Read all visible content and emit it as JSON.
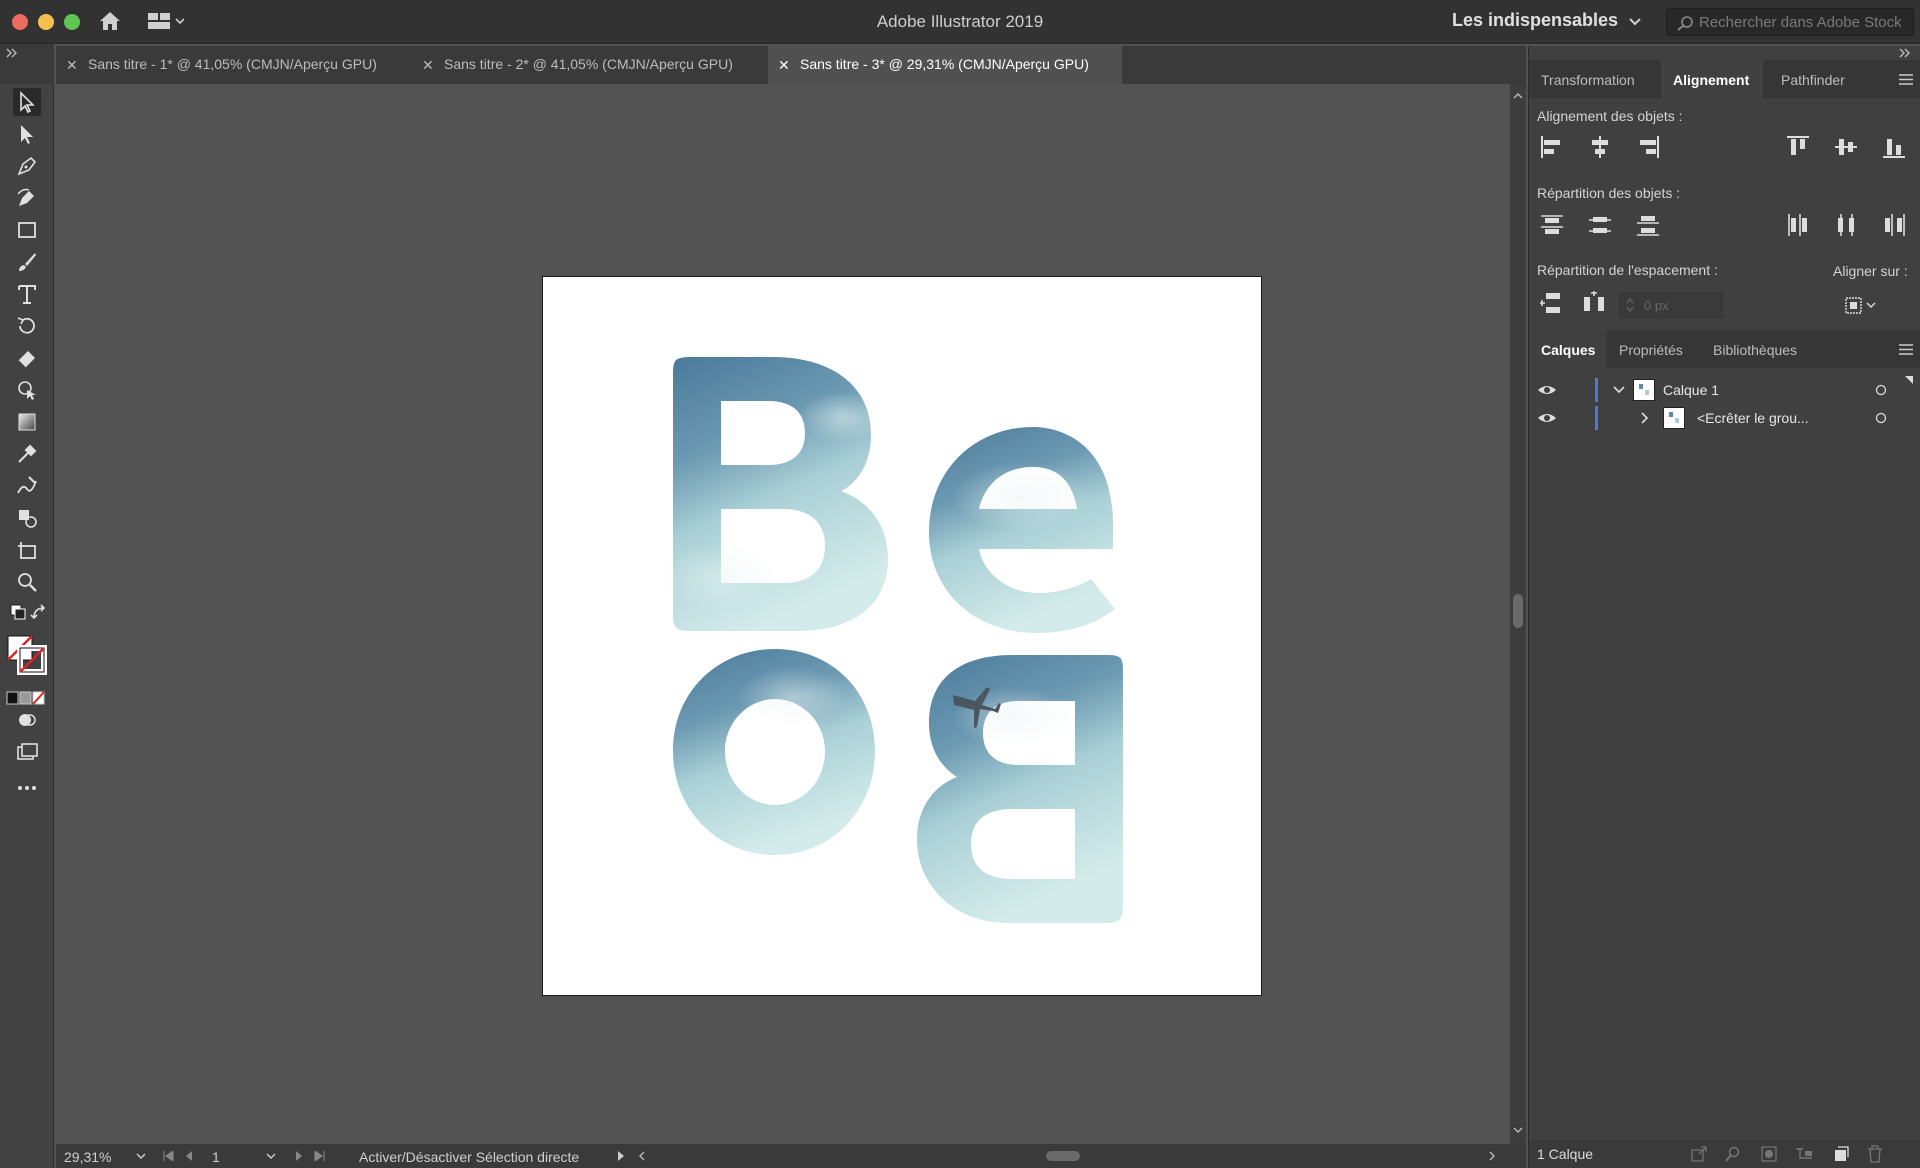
{
  "window": {
    "title": "Adobe Illustrator 2019",
    "workspace": "Les indispensables",
    "search_placeholder": "Rechercher dans Adobe Stock"
  },
  "tabs": [
    {
      "label": "Sans titre - 1* @ 41,05% (CMJN/Aperçu GPU)"
    },
    {
      "label": "Sans titre - 2* @ 41,05% (CMJN/Aperçu GPU)"
    },
    {
      "label": "Sans titre - 3* @ 29,31% (CMJN/Aperçu GPU)",
      "active": true
    }
  ],
  "panel_top": {
    "tabs": [
      "Transformation",
      "Alignement",
      "Pathfinder"
    ],
    "active_tab": "Alignement",
    "align_objects_label": "Alignement des objets :",
    "distribute_objects_label": "Répartition des objets :",
    "distribute_spacing_label": "Répartition de l'espacement :",
    "align_to_label": "Aligner sur :",
    "spacing_value": "0 px"
  },
  "panel_layers": {
    "tabs": [
      "Calques",
      "Propriétés",
      "Bibliothèques"
    ],
    "active_tab": "Calques",
    "layers": [
      {
        "name": "Calque 1",
        "expanded": true
      },
      {
        "name": "<Ecrêter le grou...",
        "expanded": false
      }
    ],
    "footer_count": "1 Calque"
  },
  "status": {
    "zoom": "29,31%",
    "page": "1",
    "message": "Activer/Désactiver Sélection directe"
  },
  "artwork": {
    "letters": [
      "B",
      "e",
      "o",
      "B"
    ]
  },
  "colors": {
    "accent": "#4a7ad8",
    "sky_dark": "#4f7f9f",
    "sky_light": "#c9e4e6"
  }
}
